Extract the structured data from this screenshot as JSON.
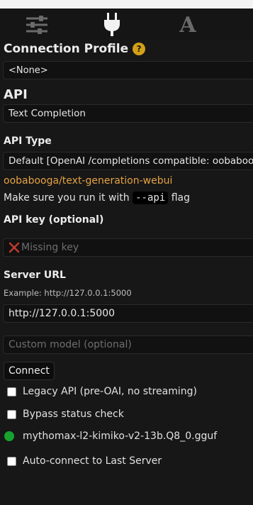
{
  "tabs": [
    {
      "icon": "sliders-icon"
    },
    {
      "icon": "plug-icon"
    },
    {
      "icon": "font-a-icon"
    }
  ],
  "connection_profile": {
    "label": "Connection Profile",
    "help": "?",
    "value": "<None>"
  },
  "api": {
    "label": "API",
    "value": "Text Completion"
  },
  "api_type": {
    "label": "API Type",
    "value": "Default [OpenAI /completions compatible: oobabooga, LM Studio, etc.]",
    "link": "oobabooga/text-generation-webui",
    "note_before": "Make sure you run it with",
    "note_code": "--api",
    "note_after": "flag"
  },
  "api_key": {
    "label": "API key (optional)",
    "placeholder": "Missing key",
    "icon": "x-icon",
    "icon_color": "#c0392b"
  },
  "server_url": {
    "label": "Server URL",
    "example": "Example: http://127.0.0.1:5000",
    "value": "http://127.0.0.1:5000"
  },
  "custom_model": {
    "placeholder": "Custom model (optional)"
  },
  "connect_label": "Connect",
  "options": {
    "legacy_api": "Legacy API (pre-OAI, no streaming)",
    "bypass_status": "Bypass status check",
    "auto_connect": "Auto-connect to Last Server"
  },
  "status": {
    "model": "mythomax-l2-kimiko-v2-13b.Q8_0.gguf",
    "color": "#17a22f"
  }
}
